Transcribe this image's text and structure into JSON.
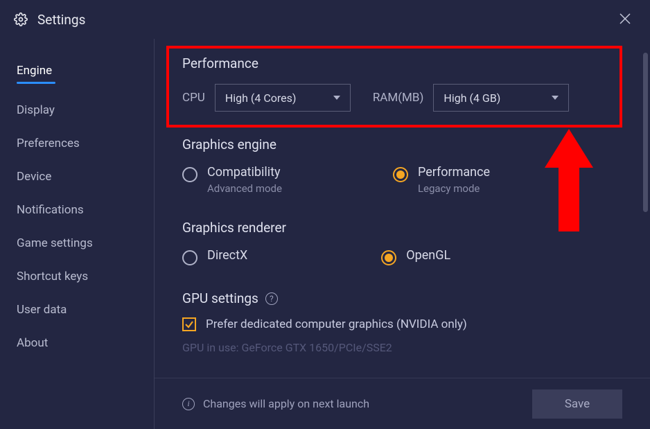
{
  "header": {
    "title": "Settings"
  },
  "sidebar": {
    "items": [
      {
        "label": "Engine",
        "active": true
      },
      {
        "label": "Display"
      },
      {
        "label": "Preferences"
      },
      {
        "label": "Device"
      },
      {
        "label": "Notifications"
      },
      {
        "label": "Game settings"
      },
      {
        "label": "Shortcut keys"
      },
      {
        "label": "User data"
      },
      {
        "label": "About"
      }
    ]
  },
  "performance": {
    "title": "Performance",
    "cpu_label": "CPU",
    "cpu_value": "High (4 Cores)",
    "ram_label": "RAM(MB)",
    "ram_value": "High (4 GB)"
  },
  "graphics_engine": {
    "title": "Graphics engine",
    "options": [
      {
        "label": "Compatibility",
        "sub": "Advanced mode",
        "selected": false
      },
      {
        "label": "Performance",
        "sub": "Legacy mode",
        "selected": true
      }
    ]
  },
  "graphics_renderer": {
    "title": "Graphics renderer",
    "options": [
      {
        "label": "DirectX",
        "selected": false
      },
      {
        "label": "OpenGL",
        "selected": true
      }
    ]
  },
  "gpu": {
    "title": "GPU settings",
    "checkbox_label": "Prefer dedicated computer graphics (NVIDIA only)",
    "checked": true,
    "in_use": "GPU in use: GeForce GTX 1650/PCIe/SSE2"
  },
  "footer": {
    "note": "Changes will apply on next launch",
    "save": "Save"
  },
  "annotation": {
    "highlight_color": "#ff0000"
  }
}
